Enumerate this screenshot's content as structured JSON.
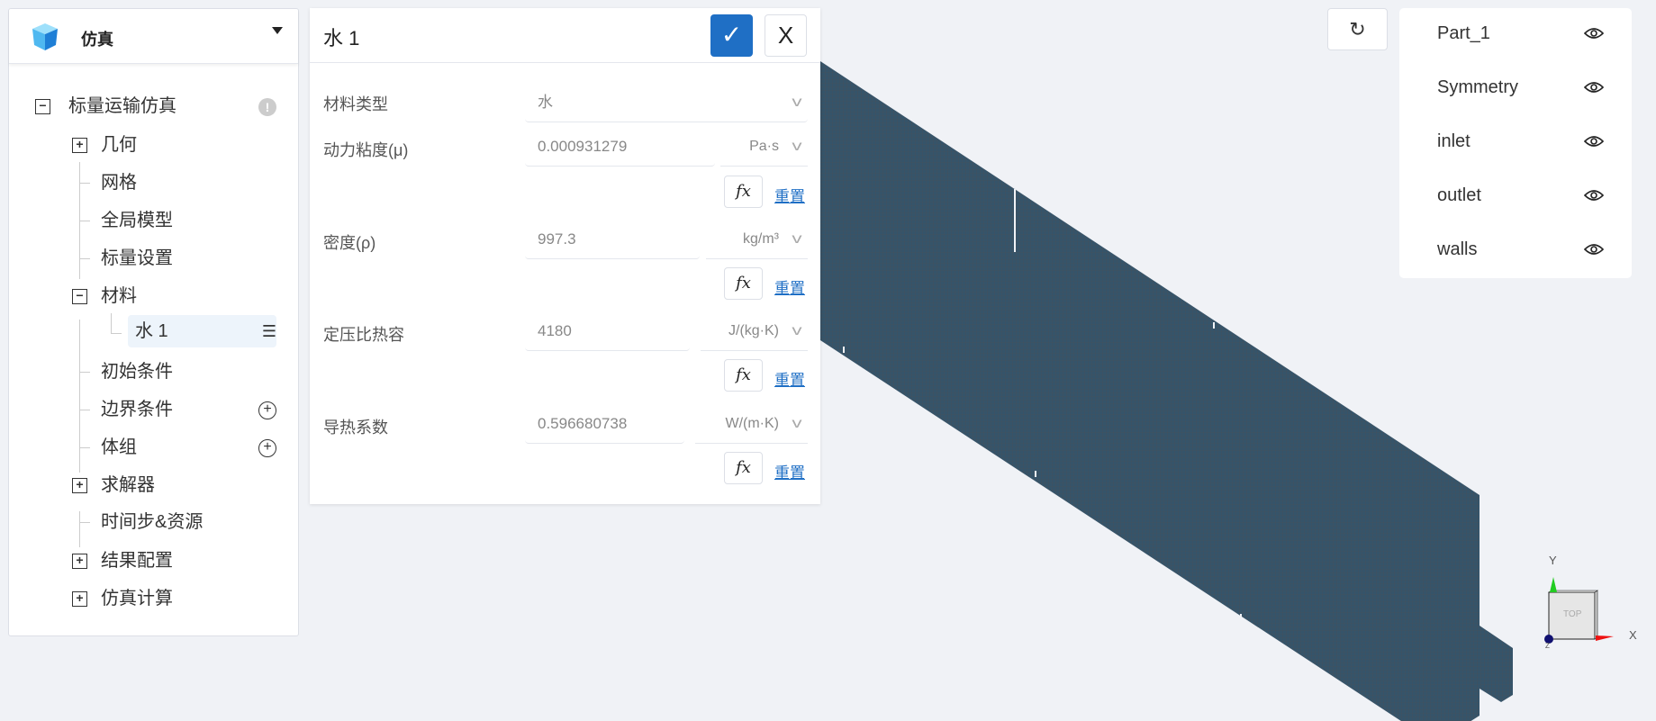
{
  "app": {
    "title": "仿真",
    "logo_icon": "cube-icon"
  },
  "tree": {
    "root": "标量运输仿真",
    "items": [
      {
        "label": "几何",
        "expand": "+"
      },
      {
        "label": "网格"
      },
      {
        "label": "全局模型"
      },
      {
        "label": "标量设置"
      },
      {
        "label": "材料",
        "expand": "-"
      },
      {
        "label": "水 1",
        "selected": true
      },
      {
        "label": "初始条件"
      },
      {
        "label": "边界条件"
      },
      {
        "label": "体组"
      },
      {
        "label": "求解器",
        "expand": "+"
      },
      {
        "label": "时间步&资源"
      },
      {
        "label": "结果配置",
        "expand": "+"
      },
      {
        "label": "仿真计算",
        "expand": "+"
      }
    ]
  },
  "dialog": {
    "title": "水 1",
    "ok_icon": "✓",
    "close_icon": "X",
    "fields": [
      {
        "label": "材料类型",
        "value": "水"
      },
      {
        "label": "动力粘度(μ)",
        "value": "0.000931279",
        "unit": "Pa·s"
      },
      {
        "label": "密度(ρ)",
        "value": "997.3",
        "unit": "kg/m³"
      },
      {
        "label": "定压比热容",
        "value": "4180",
        "unit": "J/(kg·K)"
      },
      {
        "label": "导热系数",
        "value": "0.596680738",
        "unit": "W/(m·K)"
      }
    ],
    "fx_label": "fx",
    "reset_label": "重置"
  },
  "viewer": {
    "refresh_icon": "↻",
    "parts": [
      "Part_1",
      "Symmetry",
      "inlet",
      "outlet",
      "walls"
    ],
    "axes": {
      "x": "X",
      "y": "Y",
      "z": "Z",
      "cube": "TOP"
    },
    "colors": {
      "mesh": "#3a5566",
      "accent": "#1f6fc5"
    }
  }
}
